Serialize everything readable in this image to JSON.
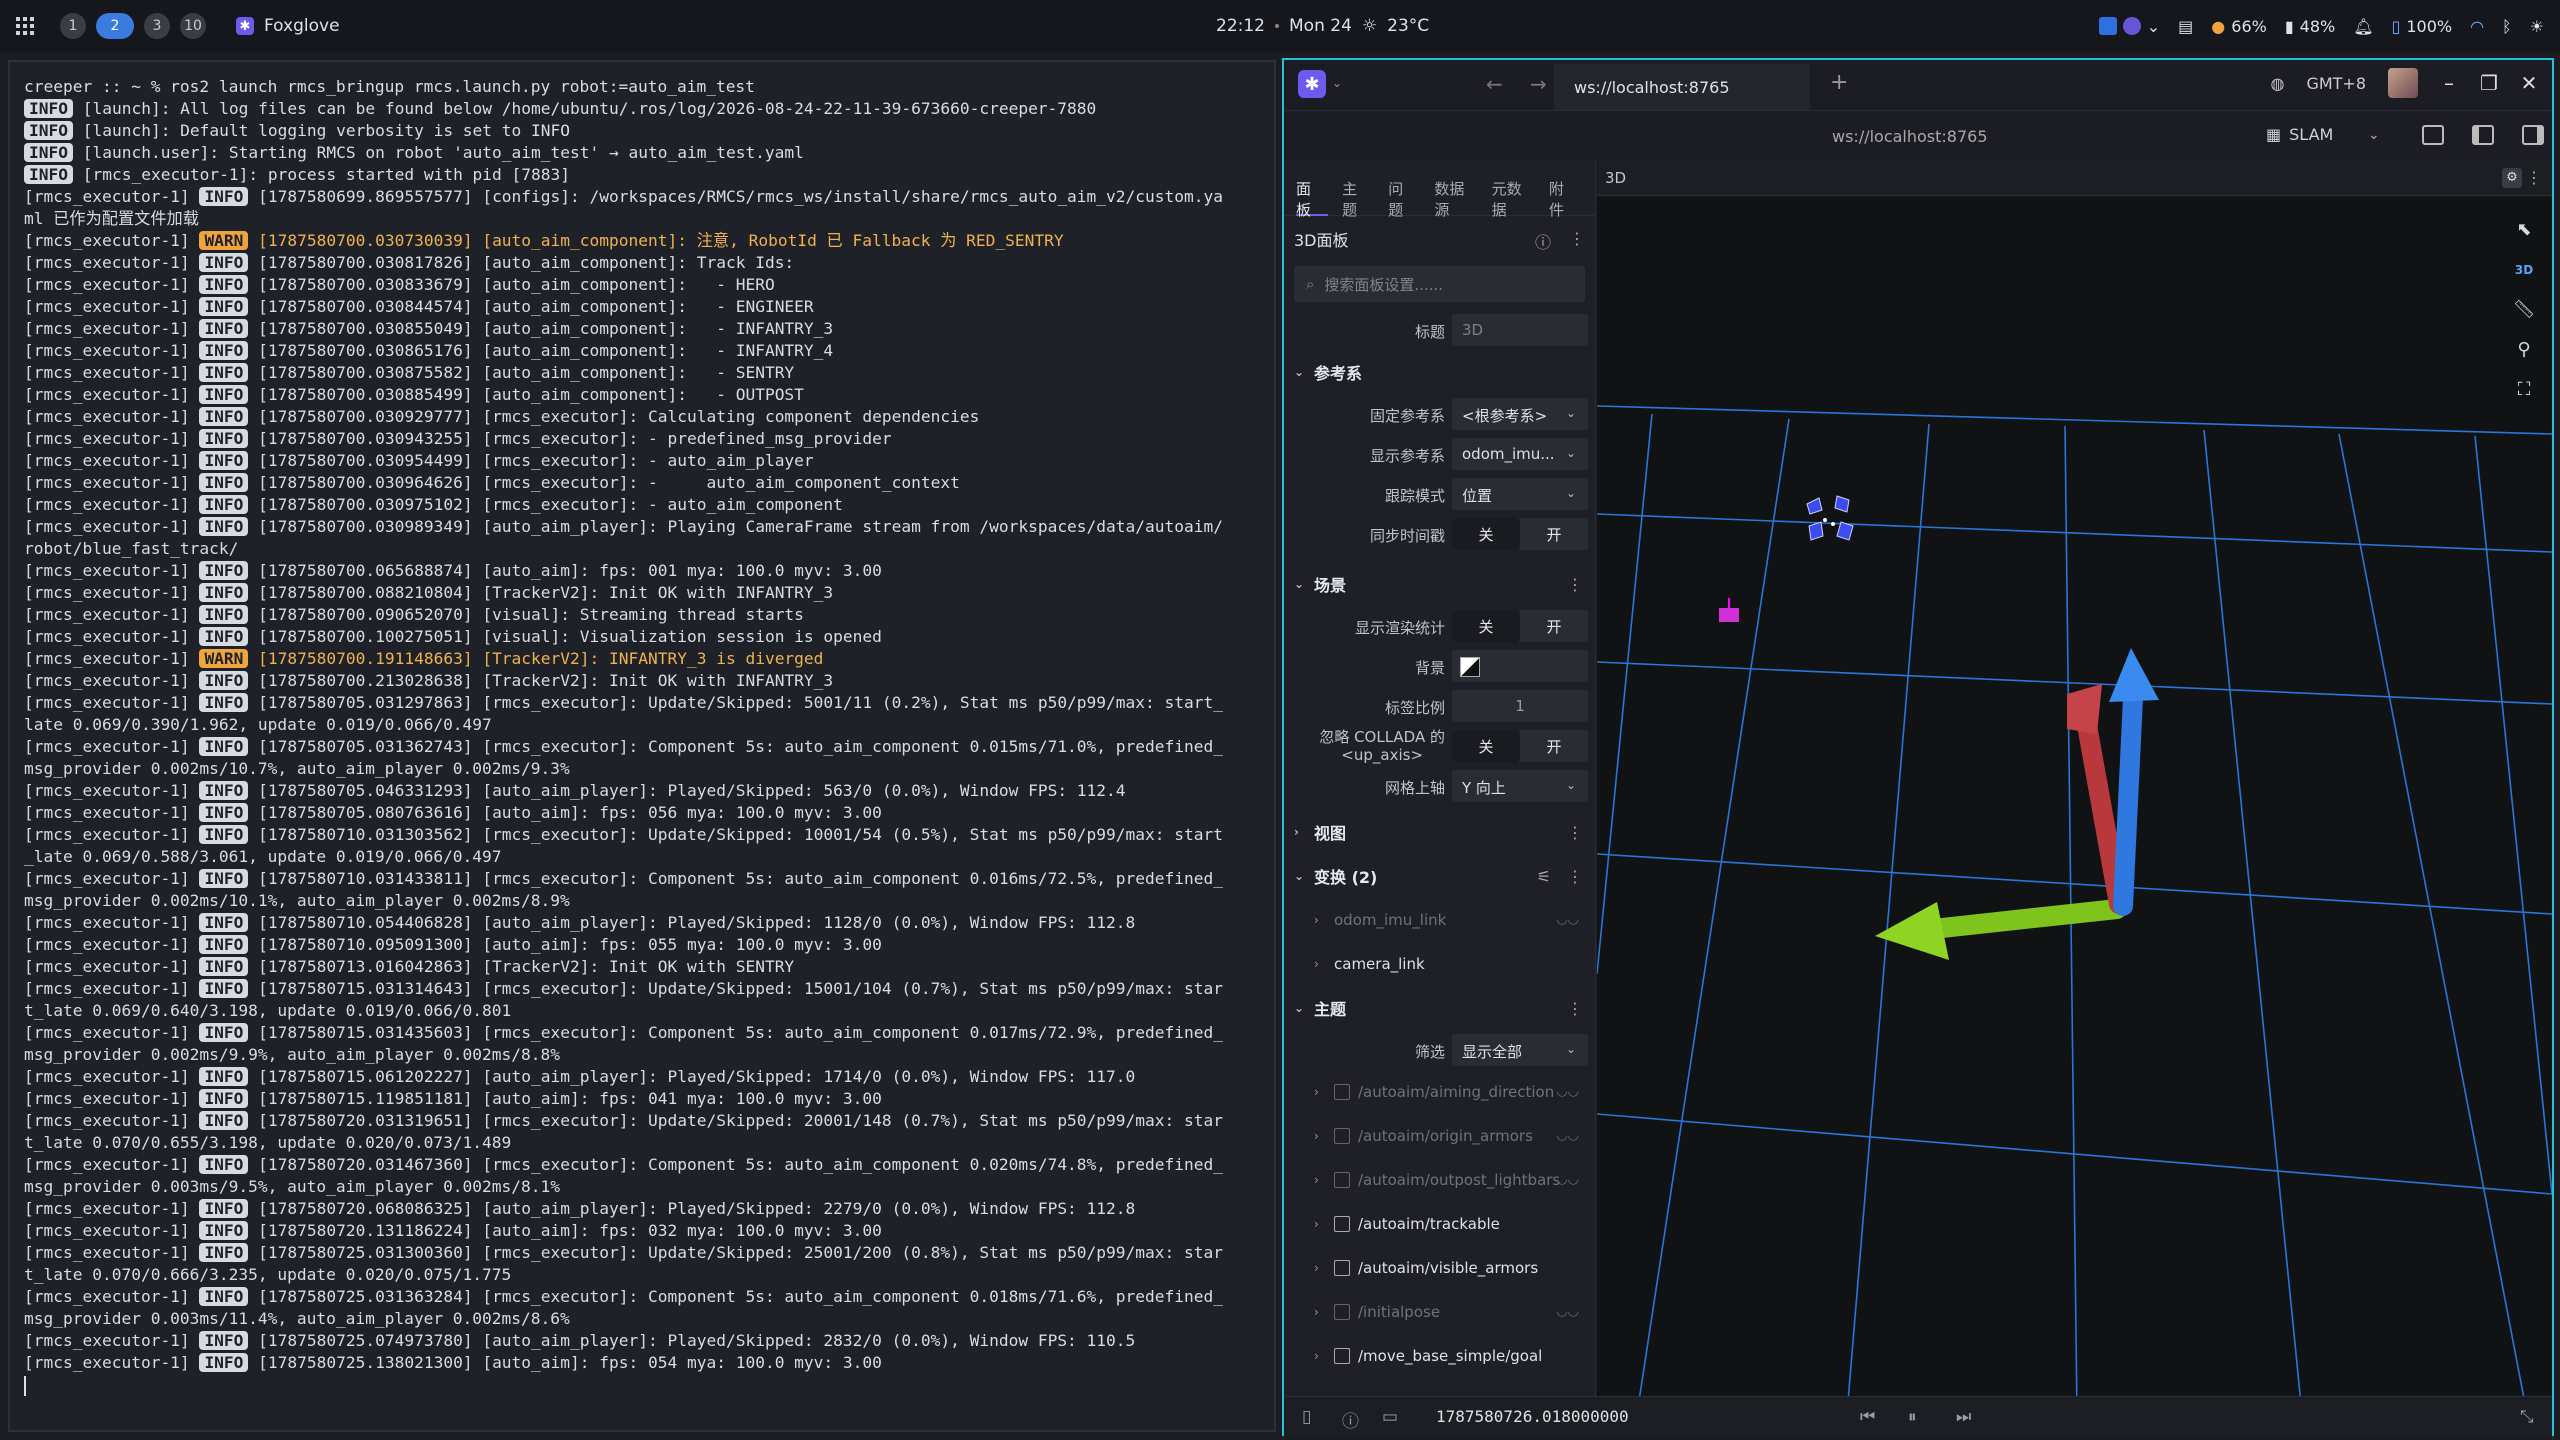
{
  "topbar": {
    "workspaces": [
      "1",
      "2",
      "3",
      "10"
    ],
    "active_workspace": "2",
    "app_name": "Foxglove",
    "time": "22:12",
    "date": "Mon 24",
    "weather": "23°C",
    "cpu": "66%",
    "battery_a": "48%",
    "battery_b": "100%"
  },
  "terminal": {
    "prompt": "creeper :: ~ % ros2 launch rmcs_bringup rmcs.launch.py robot:=auto_aim_test",
    "lines": [
      {
        "p": "",
        "l": "INFO",
        "t": " [launch]: All log files can be found below /home/ubuntu/.ros/log/2026-08-24-22-11-39-673660-creeper-7880"
      },
      {
        "p": "",
        "l": "INFO",
        "t": " [launch]: Default logging verbosity is set to INFO"
      },
      {
        "p": "",
        "l": "INFO",
        "t": " [launch.user]: Starting RMCS on robot 'auto_aim_test' → auto_aim_test.yaml"
      },
      {
        "p": "",
        "l": "INFO",
        "t": " [rmcs_executor-1]: process started with pid [7883]"
      },
      {
        "p": "[rmcs_executor-1] ",
        "l": "INFO",
        "t": " [1787580699.869557577] [configs]: /workspaces/RMCS/rmcs_ws/install/share/rmcs_auto_aim_v2/custom.ya"
      },
      {
        "p": "ml 已作为配置文件加载",
        "l": "",
        "t": ""
      },
      {
        "p": "[rmcs_executor-1] ",
        "l": "WARN",
        "t": " [1787580700.030730039] [auto_aim_component]: 注意, RobotId 已 Fallback 为 RED_SENTRY",
        "w": true
      },
      {
        "p": "[rmcs_executor-1] ",
        "l": "INFO",
        "t": " [1787580700.030817826] [auto_aim_component]: Track Ids:"
      },
      {
        "p": "[rmcs_executor-1] ",
        "l": "INFO",
        "t": " [1787580700.030833679] [auto_aim_component]:   - HERO"
      },
      {
        "p": "[rmcs_executor-1] ",
        "l": "INFO",
        "t": " [1787580700.030844574] [auto_aim_component]:   - ENGINEER"
      },
      {
        "p": "[rmcs_executor-1] ",
        "l": "INFO",
        "t": " [1787580700.030855049] [auto_aim_component]:   - INFANTRY_3"
      },
      {
        "p": "[rmcs_executor-1] ",
        "l": "INFO",
        "t": " [1787580700.030865176] [auto_aim_component]:   - INFANTRY_4"
      },
      {
        "p": "[rmcs_executor-1] ",
        "l": "INFO",
        "t": " [1787580700.030875582] [auto_aim_component]:   - SENTRY"
      },
      {
        "p": "[rmcs_executor-1] ",
        "l": "INFO",
        "t": " [1787580700.030885499] [auto_aim_component]:   - OUTPOST"
      },
      {
        "p": "[rmcs_executor-1] ",
        "l": "INFO",
        "t": " [1787580700.030929777] [rmcs_executor]: Calculating component dependencies"
      },
      {
        "p": "[rmcs_executor-1] ",
        "l": "INFO",
        "t": " [1787580700.030943255] [rmcs_executor]: - predefined_msg_provider"
      },
      {
        "p": "[rmcs_executor-1] ",
        "l": "INFO",
        "t": " [1787580700.030954499] [rmcs_executor]: - auto_aim_player"
      },
      {
        "p": "[rmcs_executor-1] ",
        "l": "INFO",
        "t": " [1787580700.030964626] [rmcs_executor]: -     auto_aim_component_context"
      },
      {
        "p": "[rmcs_executor-1] ",
        "l": "INFO",
        "t": " [1787580700.030975102] [rmcs_executor]: - auto_aim_component"
      },
      {
        "p": "[rmcs_executor-1] ",
        "l": "INFO",
        "t": " [1787580700.030989349] [auto_aim_player]: Playing CameraFrame stream from /workspaces/data/autoaim/"
      },
      {
        "p": "robot/blue_fast_track/",
        "l": "",
        "t": ""
      },
      {
        "p": "[rmcs_executor-1] ",
        "l": "INFO",
        "t": " [1787580700.065688874] [auto_aim]: fps: 001 mya: 100.0 myv: 3.00"
      },
      {
        "p": "[rmcs_executor-1] ",
        "l": "INFO",
        "t": " [1787580700.088210804] [TrackerV2]: Init OK with INFANTRY_3"
      },
      {
        "p": "[rmcs_executor-1] ",
        "l": "INFO",
        "t": " [1787580700.090652070] [visual]: Streaming thread starts"
      },
      {
        "p": "[rmcs_executor-1] ",
        "l": "INFO",
        "t": " [1787580700.100275051] [visual]: Visualization session is opened"
      },
      {
        "p": "[rmcs_executor-1] ",
        "l": "WARN",
        "t": " [1787580700.191148663] [TrackerV2]: INFANTRY_3 is diverged",
        "w": true
      },
      {
        "p": "[rmcs_executor-1] ",
        "l": "INFO",
        "t": " [1787580700.213028638] [TrackerV2]: Init OK with INFANTRY_3"
      },
      {
        "p": "[rmcs_executor-1] ",
        "l": "INFO",
        "t": " [1787580705.031297863] [rmcs_executor]: Update/Skipped: 5001/11 (0.2%), Stat ms p50/p99/max: start_"
      },
      {
        "p": "late 0.069/0.390/1.962, update 0.019/0.066/0.497",
        "l": "",
        "t": ""
      },
      {
        "p": "[rmcs_executor-1] ",
        "l": "INFO",
        "t": " [1787580705.031362743] [rmcs_executor]: Component 5s: auto_aim_component 0.015ms/71.0%, predefined_"
      },
      {
        "p": "msg_provider 0.002ms/10.7%, auto_aim_player 0.002ms/9.3%",
        "l": "",
        "t": ""
      },
      {
        "p": "[rmcs_executor-1] ",
        "l": "INFO",
        "t": " [1787580705.046331293] [auto_aim_player]: Played/Skipped: 563/0 (0.0%), Window FPS: 112.4"
      },
      {
        "p": "[rmcs_executor-1] ",
        "l": "INFO",
        "t": " [1787580705.080763616] [auto_aim]: fps: 056 mya: 100.0 myv: 3.00"
      },
      {
        "p": "[rmcs_executor-1] ",
        "l": "INFO",
        "t": " [1787580710.031303562] [rmcs_executor]: Update/Skipped: 10001/54 (0.5%), Stat ms p50/p99/max: start"
      },
      {
        "p": "_late 0.069/0.588/3.061, update 0.019/0.066/0.497",
        "l": "",
        "t": ""
      },
      {
        "p": "[rmcs_executor-1] ",
        "l": "INFO",
        "t": " [1787580710.031433811] [rmcs_executor]: Component 5s: auto_aim_component 0.016ms/72.5%, predefined_"
      },
      {
        "p": "msg_provider 0.002ms/10.1%, auto_aim_player 0.002ms/8.9%",
        "l": "",
        "t": ""
      },
      {
        "p": "[rmcs_executor-1] ",
        "l": "INFO",
        "t": " [1787580710.054406828] [auto_aim_player]: Played/Skipped: 1128/0 (0.0%), Window FPS: 112.8"
      },
      {
        "p": "[rmcs_executor-1] ",
        "l": "INFO",
        "t": " [1787580710.095091300] [auto_aim]: fps: 055 mya: 100.0 myv: 3.00"
      },
      {
        "p": "[rmcs_executor-1] ",
        "l": "INFO",
        "t": " [1787580713.016042863] [TrackerV2]: Init OK with SENTRY"
      },
      {
        "p": "[rmcs_executor-1] ",
        "l": "INFO",
        "t": " [1787580715.031314643] [rmcs_executor]: Update/Skipped: 15001/104 (0.7%), Stat ms p50/p99/max: star"
      },
      {
        "p": "t_late 0.069/0.640/3.198, update 0.019/0.066/0.801",
        "l": "",
        "t": ""
      },
      {
        "p": "[rmcs_executor-1] ",
        "l": "INFO",
        "t": " [1787580715.031435603] [rmcs_executor]: Component 5s: auto_aim_component 0.017ms/72.9%, predefined_"
      },
      {
        "p": "msg_provider 0.002ms/9.9%, auto_aim_player 0.002ms/8.8%",
        "l": "",
        "t": ""
      },
      {
        "p": "[rmcs_executor-1] ",
        "l": "INFO",
        "t": " [1787580715.061202227] [auto_aim_player]: Played/Skipped: 1714/0 (0.0%), Window FPS: 117.0"
      },
      {
        "p": "[rmcs_executor-1] ",
        "l": "INFO",
        "t": " [1787580715.119851181] [auto_aim]: fps: 041 mya: 100.0 myv: 3.00"
      },
      {
        "p": "[rmcs_executor-1] ",
        "l": "INFO",
        "t": " [1787580720.031319651] [rmcs_executor]: Update/Skipped: 20001/148 (0.7%), Stat ms p50/p99/max: star"
      },
      {
        "p": "t_late 0.070/0.655/3.198, update 0.020/0.073/1.489",
        "l": "",
        "t": ""
      },
      {
        "p": "[rmcs_executor-1] ",
        "l": "INFO",
        "t": " [1787580720.031467360] [rmcs_executor]: Component 5s: auto_aim_component 0.020ms/74.8%, predefined_"
      },
      {
        "p": "msg_provider 0.003ms/9.5%, auto_aim_player 0.002ms/8.1%",
        "l": "",
        "t": ""
      },
      {
        "p": "[rmcs_executor-1] ",
        "l": "INFO",
        "t": " [1787580720.068086325] [auto_aim_player]: Played/Skipped: 2279/0 (0.0%), Window FPS: 112.8"
      },
      {
        "p": "[rmcs_executor-1] ",
        "l": "INFO",
        "t": " [1787580720.131186224] [auto_aim]: fps: 032 mya: 100.0 myv: 3.00"
      },
      {
        "p": "[rmcs_executor-1] ",
        "l": "INFO",
        "t": " [1787580725.031300360] [rmcs_executor]: Update/Skipped: 25001/200 (0.8%), Stat ms p50/p99/max: star"
      },
      {
        "p": "t_late 0.070/0.666/3.235, update 0.020/0.075/1.775",
        "l": "",
        "t": ""
      },
      {
        "p": "[rmcs_executor-1] ",
        "l": "INFO",
        "t": " [1787580725.031363284] [rmcs_executor]: Component 5s: auto_aim_component 0.018ms/71.6%, predefined_"
      },
      {
        "p": "msg_provider 0.003ms/11.4%, auto_aim_player 0.002ms/8.6%",
        "l": "",
        "t": ""
      },
      {
        "p": "[rmcs_executor-1] ",
        "l": "INFO",
        "t": " [1787580725.074973780] [auto_aim_player]: Played/Skipped: 2832/0 (0.0%), Window FPS: 110.5"
      },
      {
        "p": "[rmcs_executor-1] ",
        "l": "INFO",
        "t": " [1787580725.138021300] [auto_aim]: fps: 054 mya: 100.0 myv: 3.00"
      }
    ]
  },
  "foxglove": {
    "tab_url": "ws://localhost:8765",
    "address": "ws://localhost:8765",
    "timezone": "GMT+8",
    "layout_name": "SLAM",
    "side_tabs": [
      "面板",
      "主题",
      "问题",
      "数据源",
      "元数据",
      "附件"
    ],
    "panel_title": "3D面板",
    "search_placeholder": "搜索面板设置......",
    "title_label": "标题",
    "title_placeholder": "3D",
    "sections": {
      "frame": {
        "label": "参考系",
        "fixed_label": "固定参考系",
        "fixed_value": "<根参考系>",
        "display_label": "显示参考系",
        "display_value": "odom_imu...",
        "follow_label": "跟踪模式",
        "follow_value": "位置",
        "sync_label": "同步时间戳"
      },
      "scene": {
        "label": "场景",
        "stats_label": "显示渲染统计",
        "bg_label": "背景",
        "label_scale_label": "标签比例",
        "label_scale_value": "1",
        "collada_label_1": "忽略 COLLADA 的",
        "collada_label_2": "<up_axis>",
        "grid_up_label": "网格上轴",
        "grid_up_value": "Y 向上"
      },
      "view": {
        "label": "视图"
      },
      "transforms": {
        "label": "变换 (2)",
        "items": [
          "odom_imu_link",
          "camera_link"
        ]
      },
      "topics": {
        "label": "主题",
        "filter_label": "筛选",
        "filter_value": "显示全部",
        "items": [
          {
            "name": "/autoaim/aiming_direction",
            "dim": true
          },
          {
            "name": "/autoaim/origin_armors",
            "dim": true
          },
          {
            "name": "/autoaim/outpost_lightbars",
            "dim": true
          },
          {
            "name": "/autoaim/trackable",
            "dim": false
          },
          {
            "name": "/autoaim/visible_armors",
            "dim": false
          },
          {
            "name": "/initialpose",
            "dim": true
          },
          {
            "name": "/move_base_simple/goal",
            "dim": false
          }
        ]
      }
    },
    "off_label": "关",
    "on_label": "开",
    "viewer_title": "3D",
    "viewer_mode": "3D",
    "playback_time": "1787580726.018000000"
  }
}
